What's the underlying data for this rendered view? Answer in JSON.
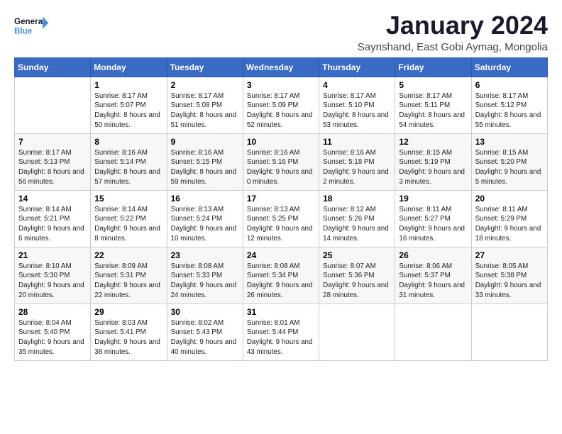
{
  "logo": {
    "general": "General",
    "blue": "Blue"
  },
  "header": {
    "title": "January 2024",
    "subtitle": "Saynshand, East Gobi Aymag, Mongolia"
  },
  "weekdays": [
    "Sunday",
    "Monday",
    "Tuesday",
    "Wednesday",
    "Thursday",
    "Friday",
    "Saturday"
  ],
  "weeks": [
    [
      {
        "day": "",
        "sunrise": "",
        "sunset": "",
        "daylight": ""
      },
      {
        "day": "1",
        "sunrise": "Sunrise: 8:17 AM",
        "sunset": "Sunset: 5:07 PM",
        "daylight": "Daylight: 8 hours and 50 minutes."
      },
      {
        "day": "2",
        "sunrise": "Sunrise: 8:17 AM",
        "sunset": "Sunset: 5:08 PM",
        "daylight": "Daylight: 8 hours and 51 minutes."
      },
      {
        "day": "3",
        "sunrise": "Sunrise: 8:17 AM",
        "sunset": "Sunset: 5:09 PM",
        "daylight": "Daylight: 8 hours and 52 minutes."
      },
      {
        "day": "4",
        "sunrise": "Sunrise: 8:17 AM",
        "sunset": "Sunset: 5:10 PM",
        "daylight": "Daylight: 8 hours and 53 minutes."
      },
      {
        "day": "5",
        "sunrise": "Sunrise: 8:17 AM",
        "sunset": "Sunset: 5:11 PM",
        "daylight": "Daylight: 8 hours and 54 minutes."
      },
      {
        "day": "6",
        "sunrise": "Sunrise: 8:17 AM",
        "sunset": "Sunset: 5:12 PM",
        "daylight": "Daylight: 8 hours and 55 minutes."
      }
    ],
    [
      {
        "day": "7",
        "sunrise": "Sunrise: 8:17 AM",
        "sunset": "Sunset: 5:13 PM",
        "daylight": "Daylight: 8 hours and 56 minutes."
      },
      {
        "day": "8",
        "sunrise": "Sunrise: 8:16 AM",
        "sunset": "Sunset: 5:14 PM",
        "daylight": "Daylight: 8 hours and 57 minutes."
      },
      {
        "day": "9",
        "sunrise": "Sunrise: 8:16 AM",
        "sunset": "Sunset: 5:15 PM",
        "daylight": "Daylight: 8 hours and 59 minutes."
      },
      {
        "day": "10",
        "sunrise": "Sunrise: 8:16 AM",
        "sunset": "Sunset: 5:16 PM",
        "daylight": "Daylight: 9 hours and 0 minutes."
      },
      {
        "day": "11",
        "sunrise": "Sunrise: 8:16 AM",
        "sunset": "Sunset: 5:18 PM",
        "daylight": "Daylight: 9 hours and 2 minutes."
      },
      {
        "day": "12",
        "sunrise": "Sunrise: 8:15 AM",
        "sunset": "Sunset: 5:19 PM",
        "daylight": "Daylight: 9 hours and 3 minutes."
      },
      {
        "day": "13",
        "sunrise": "Sunrise: 8:15 AM",
        "sunset": "Sunset: 5:20 PM",
        "daylight": "Daylight: 9 hours and 5 minutes."
      }
    ],
    [
      {
        "day": "14",
        "sunrise": "Sunrise: 8:14 AM",
        "sunset": "Sunset: 5:21 PM",
        "daylight": "Daylight: 9 hours and 6 minutes."
      },
      {
        "day": "15",
        "sunrise": "Sunrise: 8:14 AM",
        "sunset": "Sunset: 5:22 PM",
        "daylight": "Daylight: 9 hours and 8 minutes."
      },
      {
        "day": "16",
        "sunrise": "Sunrise: 8:13 AM",
        "sunset": "Sunset: 5:24 PM",
        "daylight": "Daylight: 9 hours and 10 minutes."
      },
      {
        "day": "17",
        "sunrise": "Sunrise: 8:13 AM",
        "sunset": "Sunset: 5:25 PM",
        "daylight": "Daylight: 9 hours and 12 minutes."
      },
      {
        "day": "18",
        "sunrise": "Sunrise: 8:12 AM",
        "sunset": "Sunset: 5:26 PM",
        "daylight": "Daylight: 9 hours and 14 minutes."
      },
      {
        "day": "19",
        "sunrise": "Sunrise: 8:11 AM",
        "sunset": "Sunset: 5:27 PM",
        "daylight": "Daylight: 9 hours and 16 minutes."
      },
      {
        "day": "20",
        "sunrise": "Sunrise: 8:11 AM",
        "sunset": "Sunset: 5:29 PM",
        "daylight": "Daylight: 9 hours and 18 minutes."
      }
    ],
    [
      {
        "day": "21",
        "sunrise": "Sunrise: 8:10 AM",
        "sunset": "Sunset: 5:30 PM",
        "daylight": "Daylight: 9 hours and 20 minutes."
      },
      {
        "day": "22",
        "sunrise": "Sunrise: 8:09 AM",
        "sunset": "Sunset: 5:31 PM",
        "daylight": "Daylight: 9 hours and 22 minutes."
      },
      {
        "day": "23",
        "sunrise": "Sunrise: 8:08 AM",
        "sunset": "Sunset: 5:33 PM",
        "daylight": "Daylight: 9 hours and 24 minutes."
      },
      {
        "day": "24",
        "sunrise": "Sunrise: 8:08 AM",
        "sunset": "Sunset: 5:34 PM",
        "daylight": "Daylight: 9 hours and 26 minutes."
      },
      {
        "day": "25",
        "sunrise": "Sunrise: 8:07 AM",
        "sunset": "Sunset: 5:36 PM",
        "daylight": "Daylight: 9 hours and 28 minutes."
      },
      {
        "day": "26",
        "sunrise": "Sunrise: 8:06 AM",
        "sunset": "Sunset: 5:37 PM",
        "daylight": "Daylight: 9 hours and 31 minutes."
      },
      {
        "day": "27",
        "sunrise": "Sunrise: 8:05 AM",
        "sunset": "Sunset: 5:38 PM",
        "daylight": "Daylight: 9 hours and 33 minutes."
      }
    ],
    [
      {
        "day": "28",
        "sunrise": "Sunrise: 8:04 AM",
        "sunset": "Sunset: 5:40 PM",
        "daylight": "Daylight: 9 hours and 35 minutes."
      },
      {
        "day": "29",
        "sunrise": "Sunrise: 8:03 AM",
        "sunset": "Sunset: 5:41 PM",
        "daylight": "Daylight: 9 hours and 38 minutes."
      },
      {
        "day": "30",
        "sunrise": "Sunrise: 8:02 AM",
        "sunset": "Sunset: 5:43 PM",
        "daylight": "Daylight: 9 hours and 40 minutes."
      },
      {
        "day": "31",
        "sunrise": "Sunrise: 8:01 AM",
        "sunset": "Sunset: 5:44 PM",
        "daylight": "Daylight: 9 hours and 43 minutes."
      },
      {
        "day": "",
        "sunrise": "",
        "sunset": "",
        "daylight": ""
      },
      {
        "day": "",
        "sunrise": "",
        "sunset": "",
        "daylight": ""
      },
      {
        "day": "",
        "sunrise": "",
        "sunset": "",
        "daylight": ""
      }
    ]
  ]
}
